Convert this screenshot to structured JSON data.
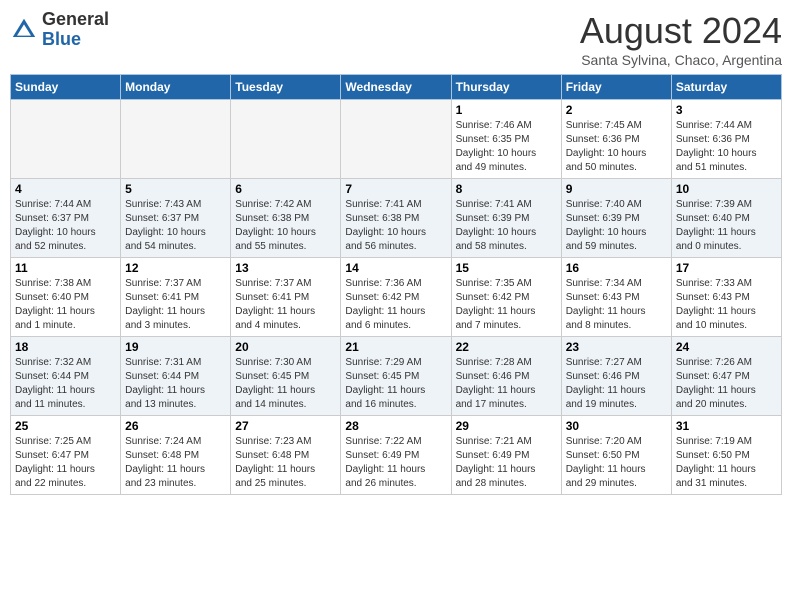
{
  "header": {
    "logo_general": "General",
    "logo_blue": "Blue",
    "month_year": "August 2024",
    "location": "Santa Sylvina, Chaco, Argentina"
  },
  "days_of_week": [
    "Sunday",
    "Monday",
    "Tuesday",
    "Wednesday",
    "Thursday",
    "Friday",
    "Saturday"
  ],
  "weeks": [
    [
      {
        "day": "",
        "info": ""
      },
      {
        "day": "",
        "info": ""
      },
      {
        "day": "",
        "info": ""
      },
      {
        "day": "",
        "info": ""
      },
      {
        "day": "1",
        "info": "Sunrise: 7:46 AM\nSunset: 6:35 PM\nDaylight: 10 hours\nand 49 minutes."
      },
      {
        "day": "2",
        "info": "Sunrise: 7:45 AM\nSunset: 6:36 PM\nDaylight: 10 hours\nand 50 minutes."
      },
      {
        "day": "3",
        "info": "Sunrise: 7:44 AM\nSunset: 6:36 PM\nDaylight: 10 hours\nand 51 minutes."
      }
    ],
    [
      {
        "day": "4",
        "info": "Sunrise: 7:44 AM\nSunset: 6:37 PM\nDaylight: 10 hours\nand 52 minutes."
      },
      {
        "day": "5",
        "info": "Sunrise: 7:43 AM\nSunset: 6:37 PM\nDaylight: 10 hours\nand 54 minutes."
      },
      {
        "day": "6",
        "info": "Sunrise: 7:42 AM\nSunset: 6:38 PM\nDaylight: 10 hours\nand 55 minutes."
      },
      {
        "day": "7",
        "info": "Sunrise: 7:41 AM\nSunset: 6:38 PM\nDaylight: 10 hours\nand 56 minutes."
      },
      {
        "day": "8",
        "info": "Sunrise: 7:41 AM\nSunset: 6:39 PM\nDaylight: 10 hours\nand 58 minutes."
      },
      {
        "day": "9",
        "info": "Sunrise: 7:40 AM\nSunset: 6:39 PM\nDaylight: 10 hours\nand 59 minutes."
      },
      {
        "day": "10",
        "info": "Sunrise: 7:39 AM\nSunset: 6:40 PM\nDaylight: 11 hours\nand 0 minutes."
      }
    ],
    [
      {
        "day": "11",
        "info": "Sunrise: 7:38 AM\nSunset: 6:40 PM\nDaylight: 11 hours\nand 1 minute."
      },
      {
        "day": "12",
        "info": "Sunrise: 7:37 AM\nSunset: 6:41 PM\nDaylight: 11 hours\nand 3 minutes."
      },
      {
        "day": "13",
        "info": "Sunrise: 7:37 AM\nSunset: 6:41 PM\nDaylight: 11 hours\nand 4 minutes."
      },
      {
        "day": "14",
        "info": "Sunrise: 7:36 AM\nSunset: 6:42 PM\nDaylight: 11 hours\nand 6 minutes."
      },
      {
        "day": "15",
        "info": "Sunrise: 7:35 AM\nSunset: 6:42 PM\nDaylight: 11 hours\nand 7 minutes."
      },
      {
        "day": "16",
        "info": "Sunrise: 7:34 AM\nSunset: 6:43 PM\nDaylight: 11 hours\nand 8 minutes."
      },
      {
        "day": "17",
        "info": "Sunrise: 7:33 AM\nSunset: 6:43 PM\nDaylight: 11 hours\nand 10 minutes."
      }
    ],
    [
      {
        "day": "18",
        "info": "Sunrise: 7:32 AM\nSunset: 6:44 PM\nDaylight: 11 hours\nand 11 minutes."
      },
      {
        "day": "19",
        "info": "Sunrise: 7:31 AM\nSunset: 6:44 PM\nDaylight: 11 hours\nand 13 minutes."
      },
      {
        "day": "20",
        "info": "Sunrise: 7:30 AM\nSunset: 6:45 PM\nDaylight: 11 hours\nand 14 minutes."
      },
      {
        "day": "21",
        "info": "Sunrise: 7:29 AM\nSunset: 6:45 PM\nDaylight: 11 hours\nand 16 minutes."
      },
      {
        "day": "22",
        "info": "Sunrise: 7:28 AM\nSunset: 6:46 PM\nDaylight: 11 hours\nand 17 minutes."
      },
      {
        "day": "23",
        "info": "Sunrise: 7:27 AM\nSunset: 6:46 PM\nDaylight: 11 hours\nand 19 minutes."
      },
      {
        "day": "24",
        "info": "Sunrise: 7:26 AM\nSunset: 6:47 PM\nDaylight: 11 hours\nand 20 minutes."
      }
    ],
    [
      {
        "day": "25",
        "info": "Sunrise: 7:25 AM\nSunset: 6:47 PM\nDaylight: 11 hours\nand 22 minutes."
      },
      {
        "day": "26",
        "info": "Sunrise: 7:24 AM\nSunset: 6:48 PM\nDaylight: 11 hours\nand 23 minutes."
      },
      {
        "day": "27",
        "info": "Sunrise: 7:23 AM\nSunset: 6:48 PM\nDaylight: 11 hours\nand 25 minutes."
      },
      {
        "day": "28",
        "info": "Sunrise: 7:22 AM\nSunset: 6:49 PM\nDaylight: 11 hours\nand 26 minutes."
      },
      {
        "day": "29",
        "info": "Sunrise: 7:21 AM\nSunset: 6:49 PM\nDaylight: 11 hours\nand 28 minutes."
      },
      {
        "day": "30",
        "info": "Sunrise: 7:20 AM\nSunset: 6:50 PM\nDaylight: 11 hours\nand 29 minutes."
      },
      {
        "day": "31",
        "info": "Sunrise: 7:19 AM\nSunset: 6:50 PM\nDaylight: 11 hours\nand 31 minutes."
      }
    ]
  ]
}
